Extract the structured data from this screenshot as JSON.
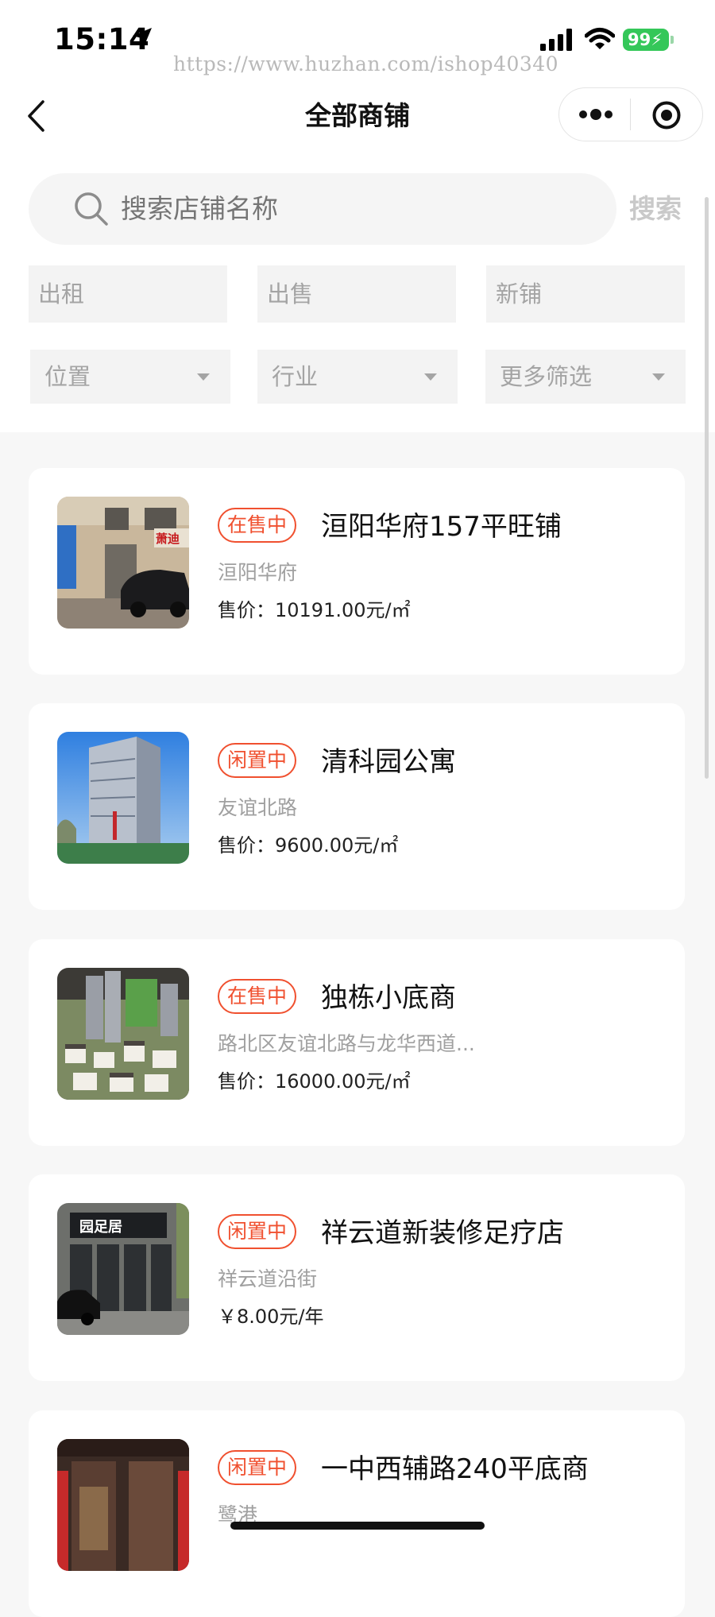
{
  "status_bar": {
    "time": "15:14",
    "battery": "99",
    "watermark": "https://www.huzhan.com/ishop40340"
  },
  "nav": {
    "title": "全部商铺"
  },
  "search": {
    "placeholder": "搜索店铺名称",
    "button": "搜索"
  },
  "tabs": [
    "出租",
    "出售",
    "新铺"
  ],
  "dropdowns": [
    "位置",
    "行业",
    "更多筛选"
  ],
  "listings": [
    {
      "badge": "在售中",
      "title": "洹阳华府157平旺铺",
      "subtitle": "洹阳华府",
      "price": "售价：10191.00元/㎡",
      "thumb": "storefront-photo"
    },
    {
      "badge": "闲置中",
      "title": "清科园公寓",
      "subtitle": "友谊北路",
      "price": "售价：9600.00元/㎡",
      "thumb": "apartment-tower-photo"
    },
    {
      "badge": "在售中",
      "title": "独栋小底商",
      "subtitle": "路北区友谊北路与龙华西道...",
      "price": "售价：16000.00元/㎡",
      "thumb": "site-model-photo"
    },
    {
      "badge": "闲置中",
      "title": "祥云道新装修足疗店",
      "subtitle": "祥云道沿街",
      "price": "￥8.00元/年",
      "thumb": "spa-storefront-photo"
    },
    {
      "badge": "闲置中",
      "title": "一中西辅路240平底商",
      "subtitle": "鹭港",
      "price": "",
      "thumb": "shop-entrance-photo"
    }
  ],
  "colors": {
    "accent": "#f0502f",
    "battery": "#34c759"
  }
}
